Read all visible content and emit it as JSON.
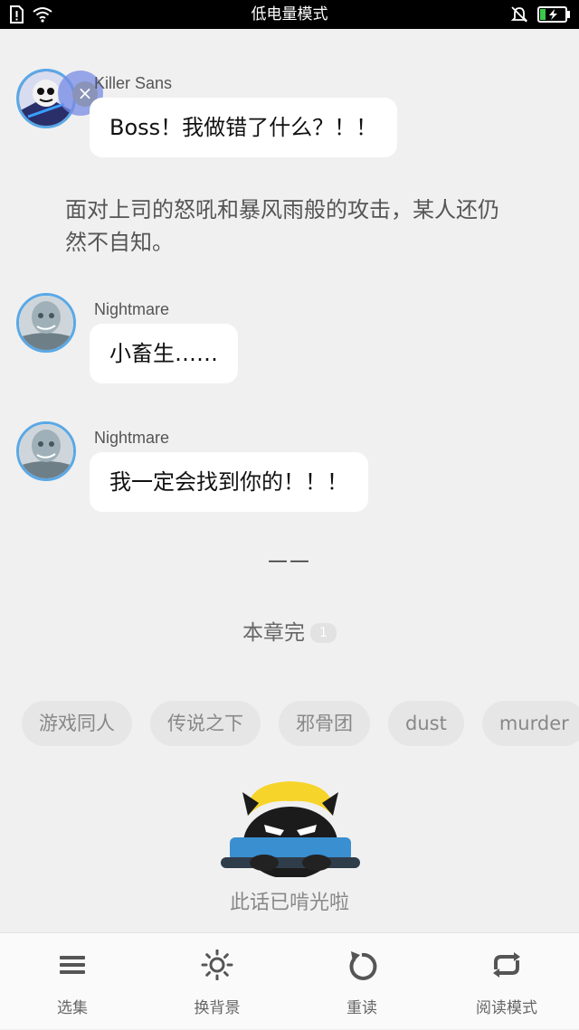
{
  "status_bar": {
    "title": "低电量模式"
  },
  "messages": [
    {
      "sender": "Killer Sans",
      "text": "Boss！我做错了什么？！！"
    },
    {
      "sender": "Nightmare",
      "text": "小畜生……"
    },
    {
      "sender": "Nightmare",
      "text": "我一定会找到你的！！！"
    }
  ],
  "close_badge": {
    "label": "×"
  },
  "narration": "面对上司的怒吼和暴风雨般的攻击，某人还仍然不自知。",
  "divider": "——",
  "chapter_end": {
    "label": "本章完",
    "count": "1"
  },
  "tags": [
    "游戏同人",
    "传说之下",
    "邪骨团",
    "dust",
    "murder"
  ],
  "end_text": "此话已啃光啦",
  "toolbar": {
    "items": [
      {
        "label": "选集",
        "icon": "menu-icon"
      },
      {
        "label": "换背景",
        "icon": "sun-icon"
      },
      {
        "label": "重读",
        "icon": "replay-icon"
      },
      {
        "label": "阅读模式",
        "icon": "loop-icon"
      }
    ]
  },
  "colors": {
    "avatar_border": "#5aa8e6",
    "background": "#f0f0f0",
    "bubble": "#ffffff",
    "battery": "#3cc84a"
  }
}
